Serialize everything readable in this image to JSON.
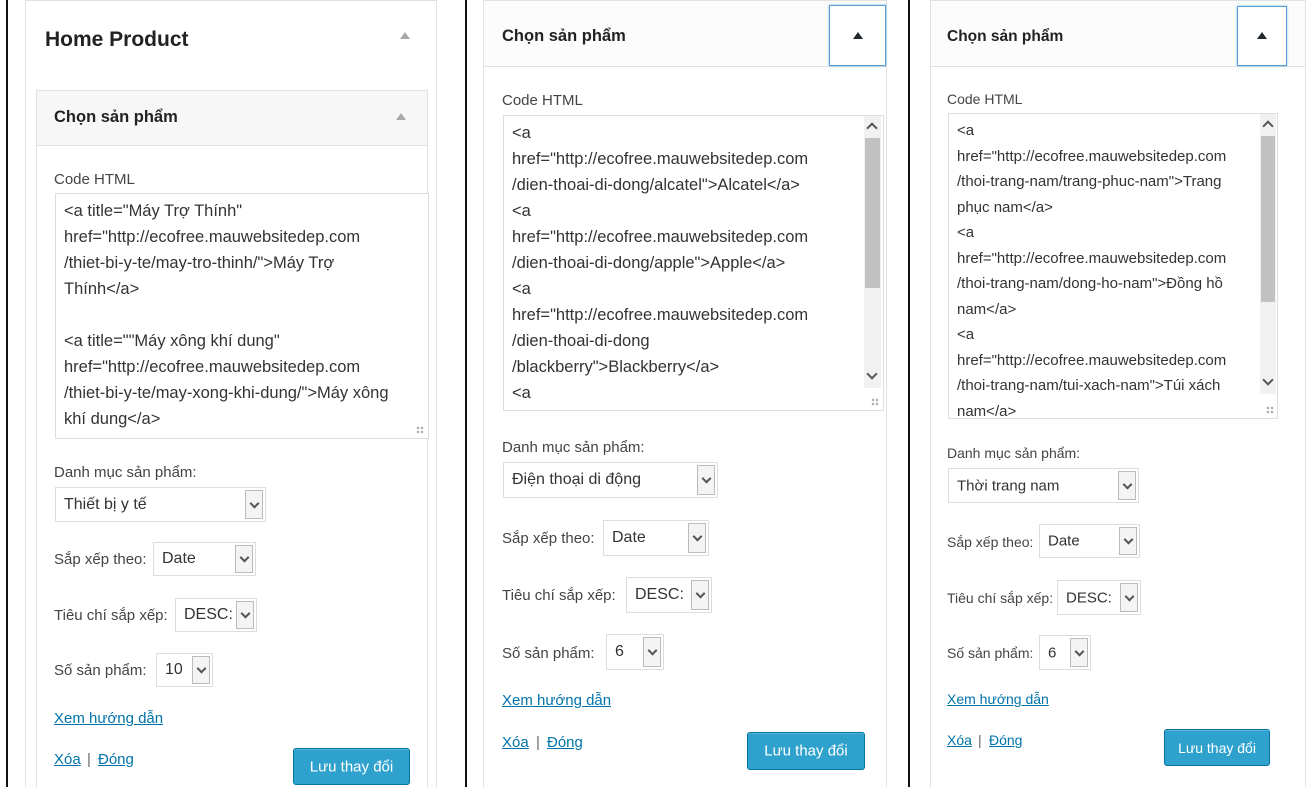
{
  "colors": {
    "accent": "#2ea2cc",
    "link": "#0073aa"
  },
  "panel1": {
    "outer_title": "Home Product",
    "title": "Chọn sản phẩm",
    "code_label": "Code HTML",
    "code_value": "<a title=\"Máy Trợ Thính\"\nhref=\"http://ecofree.mauwebsitedep.com\n/thiet-bi-y-te/may-tro-thinh/\">Máy Trợ\nThính</a>\n\n<a title=\"\"Máy xông khí dung\"\nhref=\"http://ecofree.mauwebsitedep.com\n/thiet-bi-y-te/may-xong-khi-dung/\">Máy xông\nkhí dung</a>",
    "category_label": "Danh mục sản phẩm:",
    "category_value": "Thiết bị y tế",
    "sort_label": "Sắp xếp theo:",
    "sort_value": "Date",
    "order_label": "Tiêu chí sắp xếp:",
    "order_value": "DESC:",
    "count_label": "Số sản phẩm:",
    "count_value": "10",
    "guide_link": "Xem hướng dẫn",
    "delete_link": "Xóa",
    "separator": "|",
    "close_link": "Đóng",
    "save_button": "Lưu thay đổi"
  },
  "panel2": {
    "title": "Chọn sản phẩm",
    "code_label": "Code HTML",
    "code_value": "<a\nhref=\"http://ecofree.mauwebsitedep.com\n/dien-thoai-di-dong/alcatel\">Alcatel</a>\n<a\nhref=\"http://ecofree.mauwebsitedep.com\n/dien-thoai-di-dong/apple\">Apple</a>\n<a\nhref=\"http://ecofree.mauwebsitedep.com\n/dien-thoai-di-dong\n/blackberry\">Blackberry</a>\n<a",
    "category_label": "Danh mục sản phẩm:",
    "category_value": "Điện thoại di động",
    "sort_label": "Sắp xếp theo:",
    "sort_value": "Date",
    "order_label": "Tiêu chí sắp xếp:",
    "order_value": "DESC:",
    "count_label": "Số sản phẩm:",
    "count_value": "6",
    "guide_link": "Xem hướng dẫn",
    "delete_link": "Xóa",
    "separator": "|",
    "close_link": "Đóng",
    "save_button": "Lưu thay đổi"
  },
  "panel3": {
    "title": "Chọn sản phẩm",
    "code_label": "Code HTML",
    "code_value": "<a\nhref=\"http://ecofree.mauwebsitedep.com\n/thoi-trang-nam/trang-phuc-nam\">Trang\nphục nam</a>\n<a\nhref=\"http://ecofree.mauwebsitedep.com\n/thoi-trang-nam/dong-ho-nam\">Đồng hồ\nnam</a>\n<a\nhref=\"http://ecofree.mauwebsitedep.com\n/thoi-trang-nam/tui-xach-nam\">Túi xách\nnam</a>",
    "category_label": "Danh mục sản phẩm:",
    "category_value": "Thời trang nam",
    "sort_label": "Sắp xếp theo:",
    "sort_value": "Date",
    "order_label": "Tiêu chí sắp xếp:",
    "order_value": "DESC:",
    "count_label": "Số sản phẩm:",
    "count_value": "6",
    "guide_link": "Xem hướng dẫn",
    "delete_link": "Xóa",
    "separator": "|",
    "close_link": "Đóng",
    "save_button": "Lưu thay đổi"
  }
}
